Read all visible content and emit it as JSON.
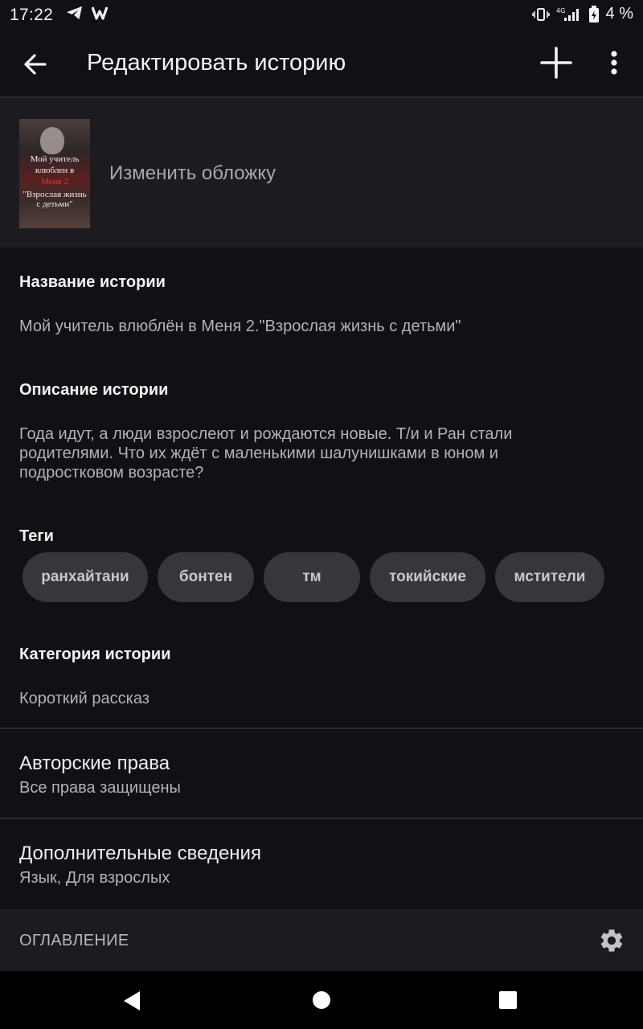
{
  "status": {
    "time": "17:22",
    "network": "4G",
    "battery": "4 %"
  },
  "appbar": {
    "title": "Редактировать историю"
  },
  "cover": {
    "label": "Изменить обложку",
    "image_text_1": "Мой учитель",
    "image_text_2": "влюблен в",
    "image_text_3": "Меня 2",
    "image_text_4": "\"Взрослая жизнь",
    "image_text_5": "с детьми\""
  },
  "title_field": {
    "label": "Название истории",
    "value": "Мой учитель влюблён в Меня 2.\"Взрослая жизнь с детьми\""
  },
  "description_field": {
    "label": "Описание истории",
    "value": "Года идут, а люди взрослеют и рождаются новые. Т/и и Ран стали родителями. Что их ждёт с маленькими шалунишками в юном и подростковом возрасте?"
  },
  "tags": {
    "label": "Теги",
    "items": [
      "ранхайтани",
      "бонтен",
      "тм",
      "токийские",
      "мстители"
    ]
  },
  "category_field": {
    "label": "Категория истории",
    "value": "Короткий рассказ"
  },
  "copyright": {
    "title": "Авторские права",
    "subtitle": "Все права защищены"
  },
  "extra_info": {
    "title": "Дополнительные сведения",
    "subtitle": "Язык, Для взрослых"
  },
  "toc": {
    "label": "ОГЛАВЛЕНИЕ"
  },
  "icons": {
    "back": "arrow-back-icon",
    "add": "plus-icon",
    "more": "more-vert-icon",
    "settings": "gear-icon"
  }
}
